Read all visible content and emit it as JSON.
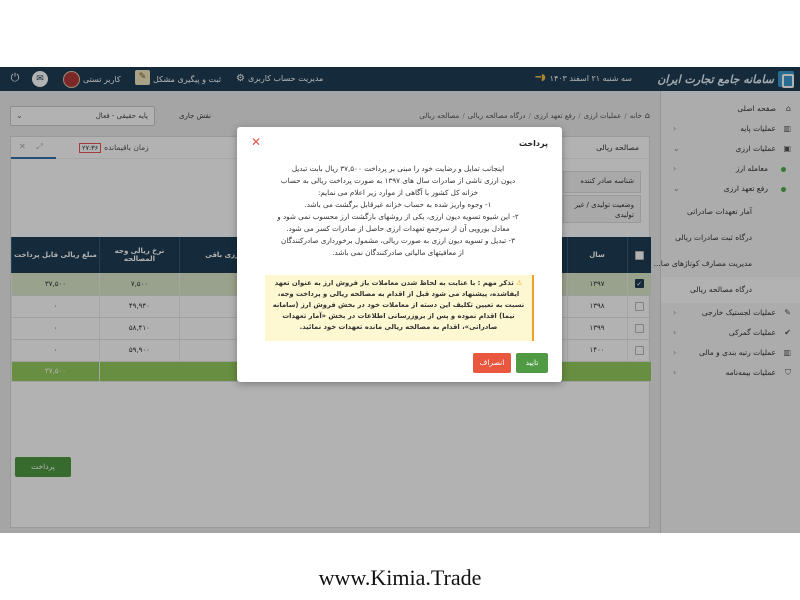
{
  "header": {
    "logo_text": "سامانه جامع تجارت ایران",
    "date": "سه شنبه ۲۱ اسفند ۱۴۰۳",
    "account_mgmt": "مدیریت حساب کاربری",
    "ticket": "ثبت و پیگیری مشکل",
    "user": "کاربر تستی",
    "bar_color": "#1f3e55"
  },
  "sidebar": {
    "items": [
      {
        "label": "صفحه اصلی",
        "icon": "home-icon"
      },
      {
        "label": "عملیات پایه",
        "icon": "chart-icon"
      },
      {
        "label": "عملیات ارزی",
        "icon": "currency-icon"
      },
      {
        "label": "معامله ارز"
      },
      {
        "label": "رفع تعهد ارزی"
      },
      {
        "label": "آمار تعهدات صادراتی"
      },
      {
        "label": "درگاه ثبت صادرات ریالی"
      },
      {
        "label": "مدیریت مصارف کوتاژهای صا..."
      },
      {
        "label": "درگاه مصالحه ریالی"
      },
      {
        "label": "عملیات لجستیک خارجی",
        "icon": "edit-icon"
      },
      {
        "label": "عملیات گمرکی",
        "icon": "check-icon"
      },
      {
        "label": "عملیات رتبه بندی و مالی",
        "icon": "chart-icon"
      },
      {
        "label": "عملیات بیمه‌نامه",
        "icon": "shield-icon"
      }
    ]
  },
  "topstrip": {
    "role_value": "پایه حقیقی - فعال",
    "role_label": "نقش جاری",
    "breadcrumb": [
      "خانه",
      "عملیات ارزی",
      "رفع تعهد ارزی",
      "درگاه مصالحه ریالی",
      "مصالحه ریالی"
    ]
  },
  "panel": {
    "title": "مصالحه ریالی",
    "time_label": "زمان باقیمانده",
    "time_value": "۲۷:۳۶",
    "field1": "شناسه صادر کننده",
    "field2": "وضعیت تولیدی / غیر تولیدی",
    "columns": [
      "سال",
      "ارزی باقی",
      "نرخ ریالی وجه المصالحه",
      "مبلغ ریالی قابل پرداخت"
    ],
    "rows": [
      {
        "year": "۱۳۹۷",
        "rate": "۷,۵۰۰",
        "amount": "۳۷,۵۰۰",
        "checked": true
      },
      {
        "year": "۱۳۹۸",
        "rate": "۴۹,۹۴۰",
        "amount": "۰",
        "checked": false
      },
      {
        "year": "۱۳۹۹",
        "rate": "۵۸,۴۱۰",
        "amount": "۰",
        "checked": false
      },
      {
        "year": "۱۴۰۰",
        "rate": "۵۹,۹۰۰",
        "amount": "۰",
        "checked": false
      }
    ],
    "sum_label": "جمع کل مبلغ ریالی قابل پرداخت (ردیف های انتخاب شده)",
    "sum_value": "۳۷,۵۰۰",
    "pay_button": "پرداخت"
  },
  "modal": {
    "title": "پرداخت",
    "body": [
      "اینجانب تمایل و رضایت خود را مبنی بر پرداخت ۳۷,۵۰۰ ریال بابت تبدیل",
      "دیون ارزی ناشی از صادرات سال های ۱۳۹۷ به صورت پرداخت ریالی به حساب",
      "خزانه کل کشور با آگاهی از موارد زیر اعلام می نمایم:",
      "۱- وجوه واریز شده به حساب خزانه غیرقابل برگشت می باشد.",
      "۲- این شیوه تسویه دیون ارزی، یکی از روشهای بازگشت ارز محسوب نمی شود و",
      "معادل یورویی آن از سرجمع تعهدات ارزی حاصل از صادرات کسر می شود.",
      "۳- تبدیل و تسویه دیون ارزی به صورت ریالی، مشمول برخورداری صادرکنندگان",
      "از معافیتهای مالیاتی صادرکنندگان نمی باشد."
    ],
    "warning": "تذکر مهم : با عنایت به لحاظ شدن معاملات باز فروش ارز به عنوان تعهد ایفاشده، پیشنهاد می شود قبل از اقدام به مصالحه ریالی و پرداخت وجه، نسبت به تعیین تکلیف این دسته از معاملات خود در بخش فروش ارز (سامانه نیما) اقدام نموده و پس از بروزرسانی اطلاعات در بخش «آمار تعهدات صادراتی»، اقدام به مصالحه ریالی مانده تعهدات خود نمائید.",
    "cancel": "انصراف",
    "ok": "تایید"
  },
  "footer": {
    "url": "www.Kimia.Trade"
  }
}
